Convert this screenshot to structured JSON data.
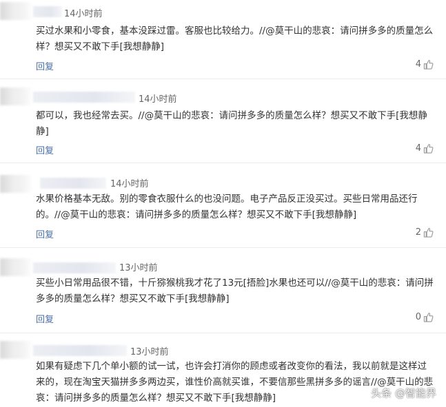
{
  "comments": [
    {
      "time": "14小时前",
      "text": "买过水果和小零食，基本没踩过雷。客服也比较给力。//@莫干山的悲哀：请问拼多多的质量怎么样？想买又不敢下手[我想静静]",
      "reply_label": "回复",
      "likes": "4"
    },
    {
      "time": "14小时前",
      "text": "都可以，我也经常去买。//@莫干山的悲哀：请问拼多多的质量怎么样？想买又不敢下手[我想静静]",
      "reply_label": "回复",
      "likes": "4"
    },
    {
      "time": "14小时前",
      "text": "水果价格基本无敌。别的零食衣服什么的也没问题。电子产品反正没买过。买些日常用品还行的。//@莫干山的悲哀：请问拼多多的质量怎么样？想买又不敢下手[我想静静]",
      "reply_label": "回复",
      "likes": "2"
    },
    {
      "time": "13小时前",
      "text": "买些小日常用品很不错，十斤猕猴桃我才花了13元[捂脸]水果也还可以//@莫干山的悲哀：请问拼多多的质量怎么样？想买又不敢下手[我想静静]",
      "reply_label": "回复",
      "likes": "0"
    },
    {
      "time": "13小时前",
      "text": "如果有疑虑下几个单小额的试一试，也许会打消你的顾虑或者改变你的看法，我以前就是这样过来的，现在淘宝天猫拼多多两边买，谁性价高就买谁，不要信那些黑拼多多的谣言//@莫干山的悲哀：请问拼多多的质量怎么样？想买又不敢下手[我想静静]"
    }
  ],
  "watermark": "头条 @智能界"
}
